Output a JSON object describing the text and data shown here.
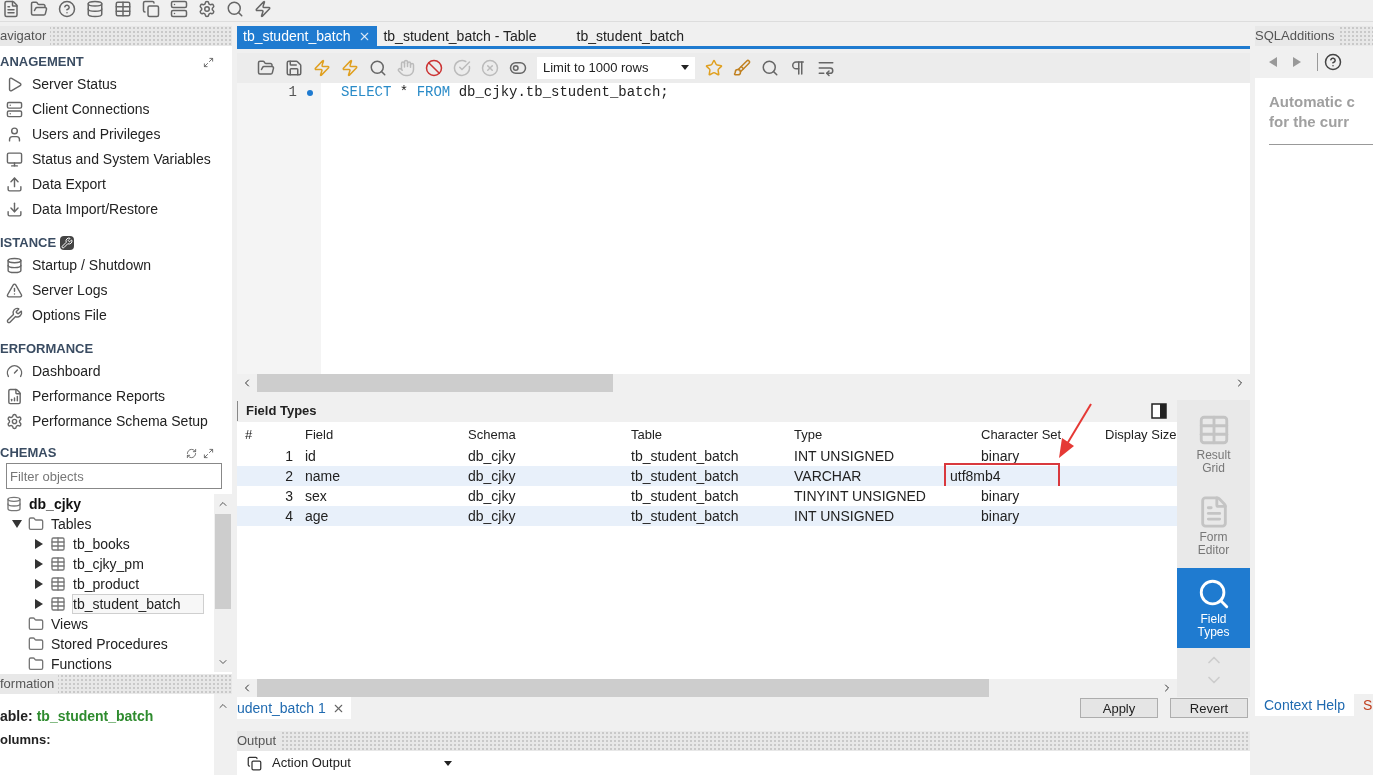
{
  "navigator": {
    "title": "avigator",
    "sections": [
      {
        "title": "ANAGEMENT",
        "kind": "management",
        "items": [
          "Server Status",
          "Client Connections",
          "Users and Privileges",
          "Status and System Variables",
          "Data Export",
          "Data Import/Restore"
        ]
      },
      {
        "title": "ISTANCE",
        "kind": "instance",
        "items": [
          "Startup / Shutdown",
          "Server Logs",
          "Options File"
        ]
      },
      {
        "title": "ERFORMANCE",
        "kind": "performance",
        "items": [
          "Dashboard",
          "Performance Reports",
          "Performance Schema Setup"
        ]
      }
    ]
  },
  "schemas": {
    "title": "CHEMAS",
    "filter": {
      "placeholder": "Filter objects"
    },
    "tree": [
      {
        "label": "db_cjky",
        "kind": "database",
        "children": [
          {
            "label": "Tables",
            "kind": "folder",
            "expanded": true,
            "children": [
              {
                "label": "tb_books",
                "kind": "table",
                "expanded": false,
                "selected": false
              },
              {
                "label": "tb_cjky_pm",
                "kind": "table",
                "expanded": false,
                "selected": false
              },
              {
                "label": "tb_product",
                "kind": "table",
                "expanded": false,
                "selected": false
              },
              {
                "label": "tb_student_batch",
                "kind": "table",
                "expanded": false,
                "selected": true
              }
            ]
          },
          {
            "label": "Views",
            "kind": "folder"
          },
          {
            "label": "Stored Procedures",
            "kind": "folder"
          },
          {
            "label": "Functions",
            "kind": "folder"
          }
        ]
      }
    ]
  },
  "information": {
    "title": "formation",
    "table_label": "able:",
    "table_name": "tb_student_batch",
    "columns_label": "olumns:"
  },
  "editor_tabs": [
    {
      "label": "tb_student_batch",
      "selected": true,
      "closable": true
    },
    {
      "label": "tb_student_batch - Table",
      "selected": false,
      "closable": false
    },
    {
      "label": "tb_student_batch",
      "selected": false,
      "closable": false
    }
  ],
  "sql_toolbar": {
    "limit": "Limit to 1000 rows"
  },
  "editor": {
    "lines": [
      {
        "number": "1",
        "tokens": [
          {
            "kind": "keyword",
            "text": "SELECT"
          },
          {
            "kind": "plain",
            "text": "*"
          },
          {
            "kind": "keyword",
            "text": "FROM"
          },
          {
            "kind": "plain",
            "text": "db_cjky.tb_student_batch;"
          }
        ]
      }
    ]
  },
  "result": {
    "title": "Field Types",
    "columns": [
      "#",
      "Field",
      "Schema",
      "Table",
      "Type",
      "Character Set",
      "Display Size"
    ],
    "rows": [
      {
        "cells": [
          "1",
          "id",
          "db_cjky",
          "tb_student_batch",
          "INT UNSIGNED",
          "binary"
        ],
        "marked": false
      },
      {
        "cells": [
          "2",
          "name",
          "db_cjky",
          "tb_student_batch",
          "VARCHAR",
          "utf8mb4"
        ],
        "marked": true
      },
      {
        "cells": [
          "3",
          "sex",
          "db_cjky",
          "tb_student_batch",
          "TINYINT UNSIGNED",
          "binary"
        ],
        "marked": false
      },
      {
        "cells": [
          "4",
          "age",
          "db_cjky",
          "tb_student_batch",
          "INT UNSIGNED",
          "binary"
        ],
        "marked": false
      }
    ],
    "views": [
      {
        "label": "Result Grid",
        "kind": "grid",
        "selected": false
      },
      {
        "label": "Form Editor",
        "kind": "form",
        "selected": false
      },
      {
        "label": "Field Types",
        "kind": "types",
        "selected": true
      }
    ],
    "tabs": [
      {
        "label": "udent_batch 1",
        "selected": true
      }
    ],
    "buttons": [
      "Apply",
      "Revert"
    ]
  },
  "output": {
    "title": "Output",
    "selector": "Action Output"
  },
  "sql_additions": {
    "title": "SQLAdditions",
    "help_lines": [
      "Automatic c",
      "for the curr"
    ],
    "tabs": [
      {
        "label": "Context Help",
        "selected": true
      },
      {
        "label": "S",
        "selected": false
      }
    ]
  }
}
